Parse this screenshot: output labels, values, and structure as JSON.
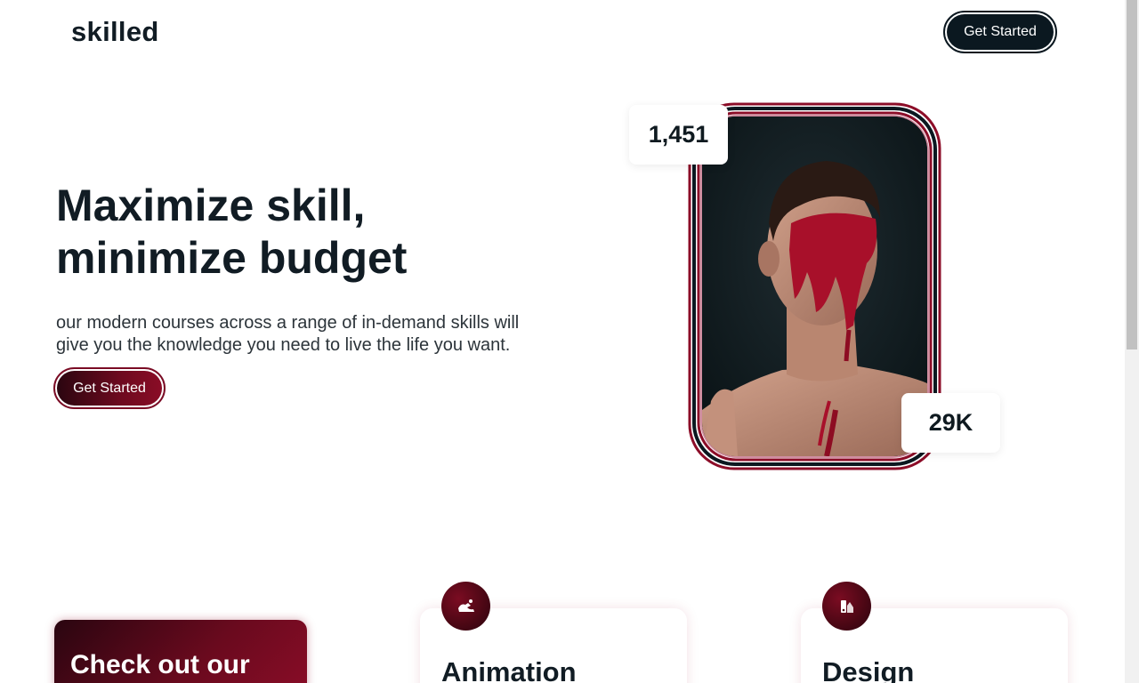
{
  "header": {
    "logo": "skilled",
    "cta_label": "Get Started"
  },
  "hero": {
    "title_lines": [
      "Maximize skill,",
      "minimize budget"
    ],
    "description_lines": [
      "our modern courses across a range of in-demand skills will",
      "give you the knowledge you need to live the life you want."
    ],
    "cta_label": "Get Started",
    "stats": [
      "1,451",
      "29K"
    ]
  },
  "promo": {
    "title": "Check out our"
  },
  "courses": [
    {
      "title": "Animation",
      "icon": "animation-icon"
    },
    {
      "title": "Design",
      "icon": "design-icon"
    }
  ],
  "colors": {
    "dark": "#0b1820",
    "accent": "#7a0b24",
    "accent_light": "#8c0d28"
  }
}
